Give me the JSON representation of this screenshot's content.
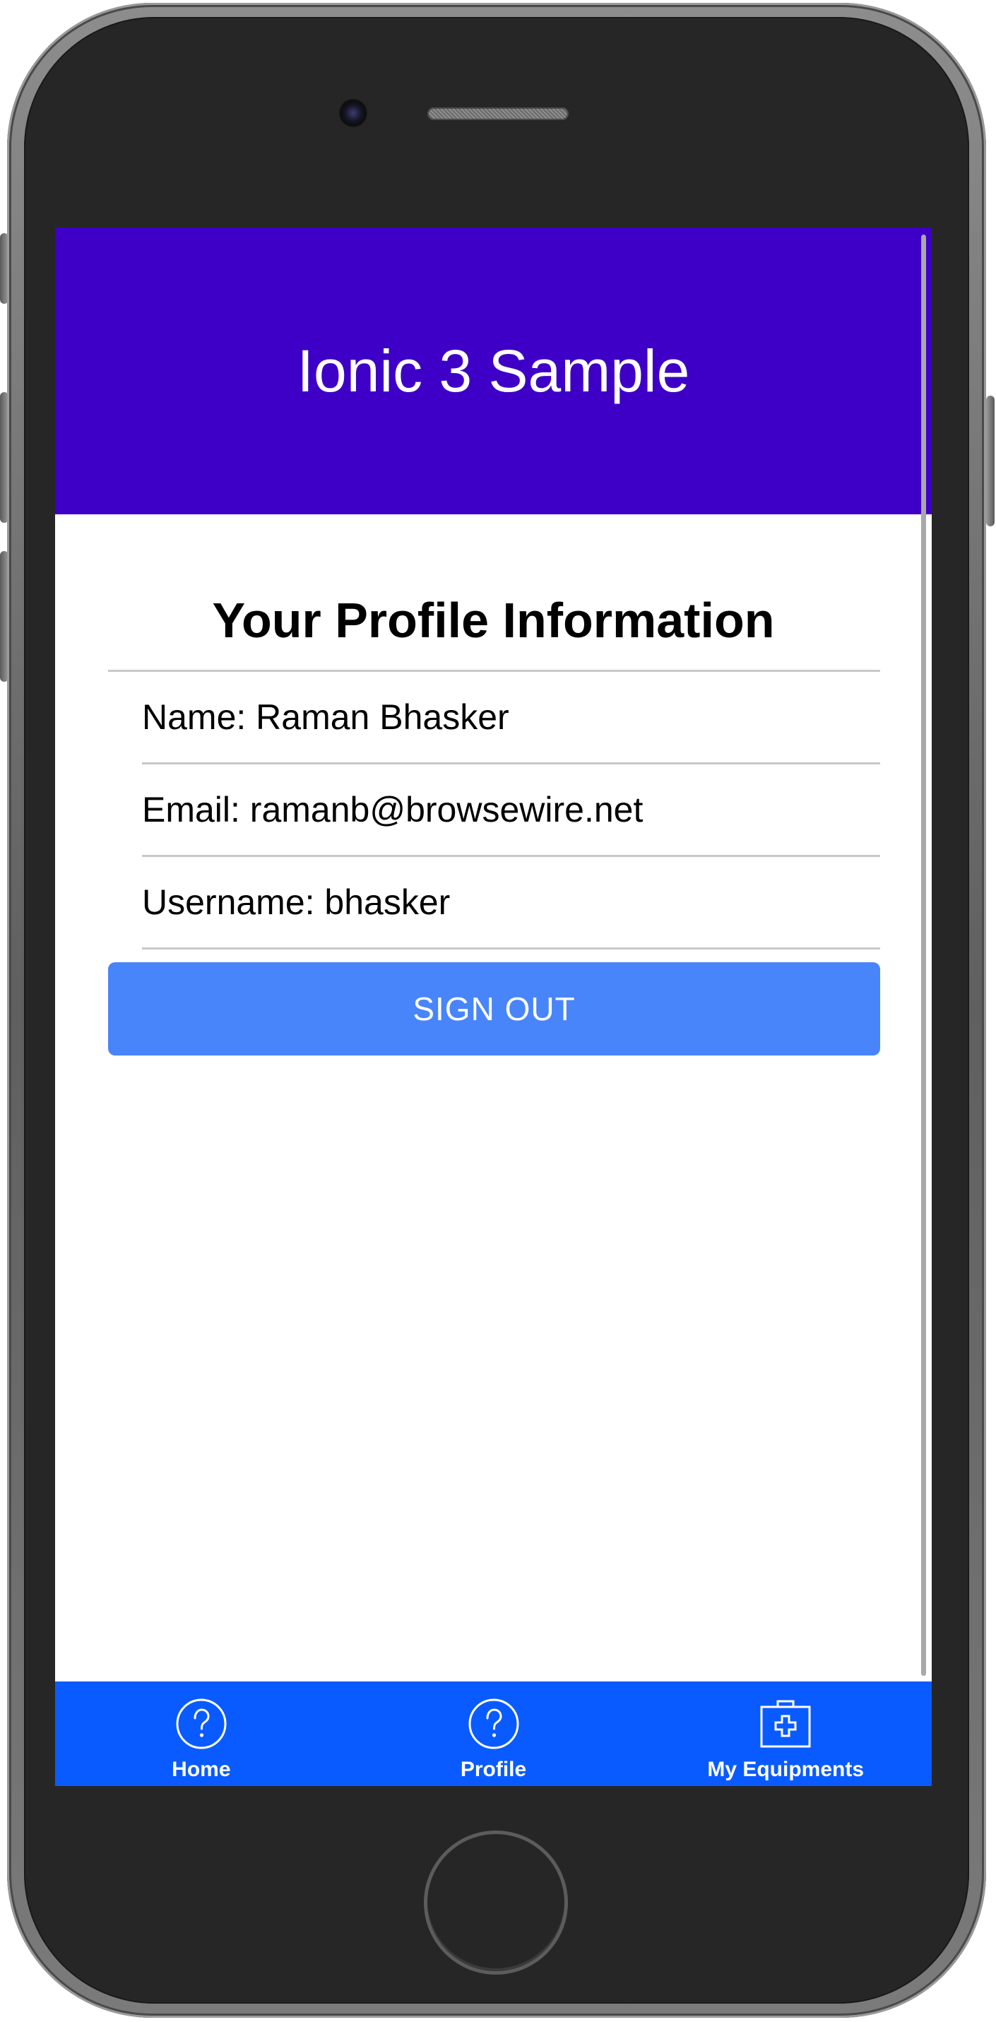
{
  "header": {
    "title": "Ionic 3 Sample"
  },
  "profile": {
    "heading": "Your Profile Information",
    "name": "Name: Raman Bhasker",
    "email": "Email: ramanb@browsewire.net",
    "username": "Username: bhasker"
  },
  "actions": {
    "signout_label": "SIGN OUT"
  },
  "tabs": [
    {
      "label": "Home",
      "icon": "help-circle-icon"
    },
    {
      "label": "Profile",
      "icon": "help-circle-icon"
    },
    {
      "label": "My Equipments",
      "icon": "medkit-icon"
    }
  ],
  "colors": {
    "header": "#3e00c7",
    "tabbar": "#0a5bff",
    "button": "#4885fa"
  }
}
